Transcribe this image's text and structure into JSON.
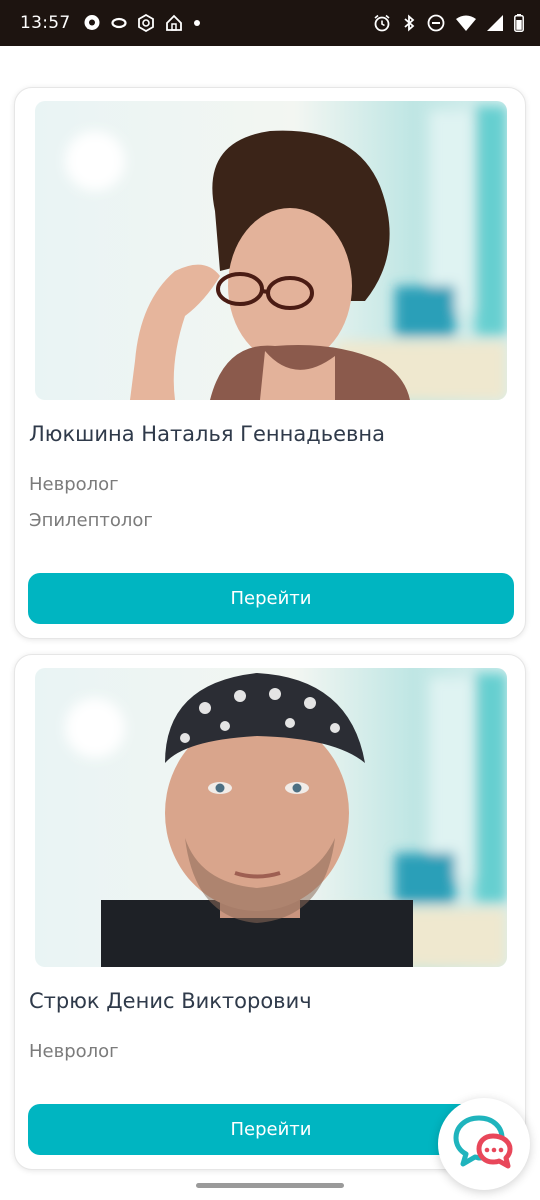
{
  "status_bar": {
    "time": "13:57",
    "left_icons": [
      "messenger-icon",
      "link-icon",
      "vpn-icon",
      "home-icon",
      "dot-icon"
    ],
    "right_icons": [
      "alarm-icon",
      "bluetooth-icon",
      "do-not-disturb-icon",
      "wifi-icon",
      "cellular-signal-icon",
      "battery-icon"
    ]
  },
  "doctors": [
    {
      "name": "Люкшина Наталья Геннадьевна",
      "specialties": [
        "Невролог",
        "Эпилептолог"
      ],
      "button_label": "Перейти"
    },
    {
      "name": "Стрюк Денис Викторович",
      "specialties": [
        "Невролог"
      ],
      "button_label": "Перейти"
    }
  ],
  "colors": {
    "accent": "#00b5c1",
    "status_bar_bg": "#1d1410",
    "name_text": "#2f3a4a",
    "specialty_text": "#7b7b7b",
    "chat_teal": "#1fb4bd",
    "chat_red": "#e8475a"
  },
  "chat_fab_icon": "chat-bubbles-icon"
}
